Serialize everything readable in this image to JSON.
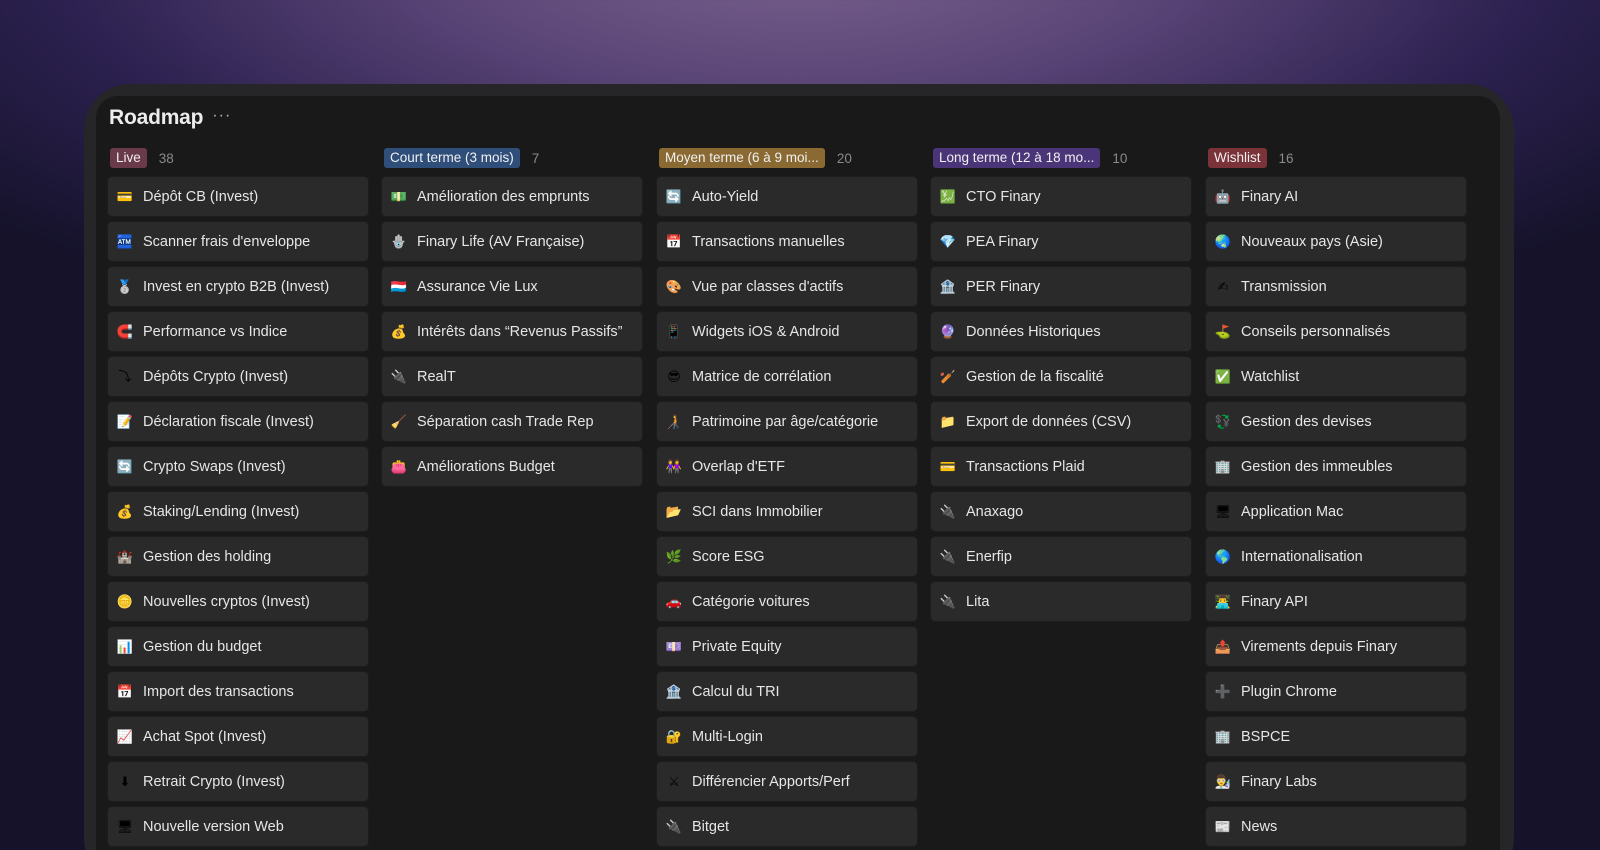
{
  "board": {
    "title": "Roadmap",
    "more": "···"
  },
  "columns": [
    {
      "name": "Live",
      "count": "38",
      "color": "#6b3a4a",
      "items": [
        {
          "icon": "💳",
          "icon_name": "credit-card-icon",
          "label": "Dépôt CB  (Invest)"
        },
        {
          "icon": "🏧",
          "icon_name": "atm-icon",
          "label": "Scanner frais d'enveloppe"
        },
        {
          "icon": "🥈",
          "icon_name": "medal-icon",
          "label": "Invest en crypto B2B (Invest)"
        },
        {
          "icon": "🧲",
          "icon_name": "magnet-icon",
          "label": "Performance vs Indice"
        },
        {
          "icon": "⤵",
          "icon_name": "arrow-down-icon",
          "label": "Dépôts Crypto (Invest)"
        },
        {
          "icon": "📝",
          "icon_name": "memo-icon",
          "label": "Déclaration fiscale (Invest)"
        },
        {
          "icon": "🔄",
          "icon_name": "swap-icon",
          "label": "Crypto Swaps (Invest)"
        },
        {
          "icon": "💰",
          "icon_name": "money-bag-icon",
          "label": "Staking/Lending (Invest)"
        },
        {
          "icon": "🏰",
          "icon_name": "castle-icon",
          "label": "Gestion des holding"
        },
        {
          "icon": "🪙",
          "icon_name": "coin-icon",
          "label": "Nouvelles cryptos (Invest)"
        },
        {
          "icon": "📊",
          "icon_name": "bar-chart-icon",
          "label": "Gestion du budget"
        },
        {
          "icon": "📅",
          "icon_name": "calendar-icon",
          "label": "Import des transactions"
        },
        {
          "icon": "📈",
          "icon_name": "chart-up-icon",
          "label": "Achat Spot (Invest)"
        },
        {
          "icon": "⬇",
          "icon_name": "down-arrow-icon",
          "label": "Retrait Crypto (Invest)"
        },
        {
          "icon": "🖥",
          "icon_name": "desktop-icon",
          "label": "Nouvelle version Web"
        }
      ]
    },
    {
      "name": "Court terme (3 mois)",
      "count": "7",
      "color": "#2f4f7a",
      "items": [
        {
          "icon": "💵",
          "icon_name": "banknote-icon",
          "label": "Amélioration des emprunts"
        },
        {
          "icon": "🪬",
          "icon_name": "hamsa-icon",
          "label": "Finary Life (AV Française)"
        },
        {
          "icon": "🇱🇺",
          "icon_name": "luxembourg-flag-icon",
          "label": "Assurance Vie Lux"
        },
        {
          "icon": "💰",
          "icon_name": "money-bag-icon",
          "label": "Intérêts dans “Revenus Passifs”"
        },
        {
          "icon": "🔌",
          "icon_name": "plug-icon",
          "label": "RealT"
        },
        {
          "icon": "🧹",
          "icon_name": "broom-icon",
          "label": "Séparation cash Trade Rep"
        },
        {
          "icon": "👛",
          "icon_name": "purse-icon",
          "label": "Améliorations Budget"
        }
      ]
    },
    {
      "name": "Moyen terme (6 à 9 mois)",
      "name_shown": "Moyen terme (6 à 9 moi...",
      "count": "20",
      "color": "#8a6a32",
      "items": [
        {
          "icon": "🔄",
          "icon_name": "repeat-icon",
          "label": "Auto-Yield"
        },
        {
          "icon": "📅",
          "icon_name": "calendar-icon",
          "label": "Transactions manuelles"
        },
        {
          "icon": "🎨",
          "icon_name": "palette-icon",
          "label": "Vue par classes d'actifs"
        },
        {
          "icon": "📱",
          "icon_name": "phone-icon",
          "label": "Widgets iOS & Android"
        },
        {
          "icon": "😎",
          "icon_name": "sunglasses-icon",
          "label": "Matrice de corrélation"
        },
        {
          "icon": "🧑‍🦯",
          "icon_name": "person-cane-icon",
          "label": "Patrimoine par âge/catégorie"
        },
        {
          "icon": "👭",
          "icon_name": "people-icon",
          "label": "Overlap d'ETF"
        },
        {
          "icon": "📂",
          "icon_name": "folder-icon",
          "label": "SCI dans Immobilier"
        },
        {
          "icon": "🌿",
          "icon_name": "leaf-icon",
          "label": "Score ESG"
        },
        {
          "icon": "🚗",
          "icon_name": "car-icon",
          "label": "Catégorie voitures"
        },
        {
          "icon": "💷",
          "icon_name": "pound-note-icon",
          "label": "Private Equity"
        },
        {
          "icon": "🏦",
          "icon_name": "bank-icon",
          "label": "Calcul du TRI"
        },
        {
          "icon": "🔐",
          "icon_name": "lock-key-icon",
          "label": "Multi-Login"
        },
        {
          "icon": "⚔",
          "icon_name": "swords-icon",
          "label": "Différencier Apports/Perf"
        },
        {
          "icon": "🔌",
          "icon_name": "plug-icon",
          "label": "Bitget"
        }
      ]
    },
    {
      "name": "Long terme (12 à 18 mois)",
      "name_shown": "Long terme (12 à 18 mo...",
      "count": "10",
      "color": "#4a3578",
      "items": [
        {
          "icon": "💹",
          "icon_name": "chart-yen-icon",
          "label": "CTO Finary"
        },
        {
          "icon": "💎",
          "icon_name": "gem-icon",
          "label": "PEA Finary"
        },
        {
          "icon": "🏦",
          "icon_name": "bank-icon",
          "label": "PER Finary"
        },
        {
          "icon": "🔮",
          "icon_name": "crystal-ball-icon",
          "label": "Données Historiques"
        },
        {
          "icon": "🏏",
          "icon_name": "cricket-icon",
          "label": "Gestion de la fiscalité"
        },
        {
          "icon": "📁",
          "icon_name": "folder-icon",
          "label": "Export de données (CSV)"
        },
        {
          "icon": "💳",
          "icon_name": "credit-card-icon",
          "label": "Transactions Plaid"
        },
        {
          "icon": "🔌",
          "icon_name": "plug-icon",
          "label": "Anaxago"
        },
        {
          "icon": "🔌",
          "icon_name": "plug-icon",
          "label": "Enerfip"
        },
        {
          "icon": "🔌",
          "icon_name": "plug-icon",
          "label": "Lita"
        }
      ]
    },
    {
      "name": "Wishlist",
      "count": "16",
      "color": "#7a3338",
      "items": [
        {
          "icon": "🤖",
          "icon_name": "robot-icon",
          "label": "Finary AI"
        },
        {
          "icon": "🌏",
          "icon_name": "globe-asia-icon",
          "label": "Nouveaux pays (Asie)"
        },
        {
          "icon": "✍",
          "icon_name": "writing-hand-icon",
          "label": "Transmission"
        },
        {
          "icon": "⛳",
          "icon_name": "golf-flag-icon",
          "label": "Conseils personnalisés"
        },
        {
          "icon": "✅",
          "icon_name": "check-icon",
          "label": "Watchlist"
        },
        {
          "icon": "💱",
          "icon_name": "currency-exchange-icon",
          "label": "Gestion des devises"
        },
        {
          "icon": "🏢",
          "icon_name": "building-icon",
          "label": "Gestion des immeubles"
        },
        {
          "icon": "🖥",
          "icon_name": "desktop-icon",
          "label": "Application Mac"
        },
        {
          "icon": "🌎",
          "icon_name": "globe-icon",
          "label": "Internationalisation"
        },
        {
          "icon": "👨‍💻",
          "icon_name": "developer-icon",
          "label": "Finary API"
        },
        {
          "icon": "📤",
          "icon_name": "outbox-icon",
          "label": "Virements depuis Finary"
        },
        {
          "icon": "➕",
          "icon_name": "plus-icon",
          "label": "Plugin Chrome"
        },
        {
          "icon": "🏢",
          "icon_name": "office-icon",
          "label": "BSPCE"
        },
        {
          "icon": "👨‍🔬",
          "icon_name": "scientist-icon",
          "label": "Finary Labs"
        },
        {
          "icon": "📰",
          "icon_name": "newspaper-icon",
          "label": "News"
        }
      ]
    }
  ]
}
